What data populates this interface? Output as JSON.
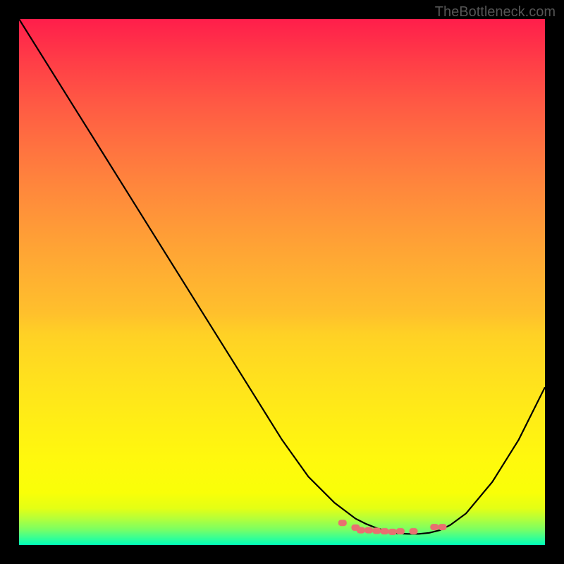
{
  "watermark": "TheBottleneck.com",
  "chart_data": {
    "type": "line",
    "title": "",
    "xlabel": "",
    "ylabel": "",
    "xlim": [
      0,
      100
    ],
    "ylim": [
      0,
      100
    ],
    "gradient_colors": {
      "top": "#ff1e4b",
      "middle": "#ffed16",
      "bottom": "#00ffb9"
    },
    "series": [
      {
        "name": "curve",
        "color": "#000000",
        "x": [
          0,
          5,
          10,
          15,
          20,
          25,
          30,
          35,
          40,
          45,
          50,
          55,
          60,
          64,
          66,
          68,
          70,
          72,
          74,
          76,
          78,
          80,
          82,
          85,
          90,
          95,
          100
        ],
        "y": [
          100,
          92,
          84,
          76,
          68,
          60,
          52,
          44,
          36,
          28,
          20,
          13,
          8,
          5,
          4,
          3.2,
          2.6,
          2.2,
          2.1,
          2.1,
          2.3,
          2.8,
          3.8,
          6,
          12,
          20,
          30
        ]
      },
      {
        "name": "markers",
        "color": "#e87070",
        "type": "scatter",
        "x": [
          61.5,
          64,
          65,
          66.5,
          68,
          69.5,
          71,
          72.5,
          75,
          79,
          80.5
        ],
        "y": [
          4.2,
          3.3,
          2.8,
          2.8,
          2.7,
          2.6,
          2.5,
          2.6,
          2.6,
          3.4,
          3.4
        ]
      }
    ]
  }
}
